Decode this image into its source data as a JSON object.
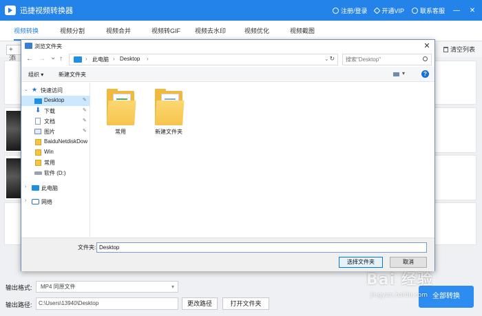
{
  "app": {
    "title": "迅捷视频转换器",
    "login": "注册/登录",
    "vip": "开通VIP",
    "support": "联系客服",
    "minimize": "—",
    "close": "✕"
  },
  "tabs": [
    {
      "label": "视频转换"
    },
    {
      "label": "视频分割"
    },
    {
      "label": "视频合并"
    },
    {
      "label": "视频转GIF"
    },
    {
      "label": "视频去水印"
    },
    {
      "label": "视频优化"
    },
    {
      "label": "视频截图"
    }
  ],
  "toolbar": {
    "add_label": "+ 添",
    "clear_label": "清空列表"
  },
  "bottom": {
    "format_label": "输出格式:",
    "format_value": "MP4  同原文件",
    "path_label": "输出路径:",
    "path_value": "C:\\Users\\13940\\Desktop",
    "change_path": "更改路径",
    "open_folder": "打开文件夹",
    "convert_all": "全部转换"
  },
  "dialog": {
    "title": "浏览文件夹",
    "close": "✕",
    "nav": {
      "back": "←",
      "forward": "→",
      "dropdown": "⌄",
      "up": "↑"
    },
    "address": {
      "segments": [
        "此电脑",
        "Desktop"
      ],
      "chevron": "›",
      "refresh": "↻"
    },
    "search_placeholder": "搜索\"Desktop\"",
    "commands": {
      "organize": "组织 ▾",
      "new_folder": "新建文件夹",
      "help": "?"
    },
    "tree": [
      {
        "label": "快速访问",
        "pinned": false
      },
      {
        "label": "Desktop",
        "pinned": true,
        "selected": true
      },
      {
        "label": "下载",
        "pinned": true
      },
      {
        "label": "文档",
        "pinned": true
      },
      {
        "label": "图片",
        "pinned": true
      },
      {
        "label": "BaiduNetdiskDow",
        "pinned": false
      },
      {
        "label": "Win",
        "pinned": false
      },
      {
        "label": "常用",
        "pinned": false
      },
      {
        "label": "软件 (D:)",
        "pinned": false
      },
      {
        "label": "此电脑",
        "pinned": false
      },
      {
        "label": "网络",
        "pinned": false
      }
    ],
    "pin_glyph": "✎",
    "expand_open": "⌄",
    "expand_closed": "›",
    "folders": [
      {
        "name": "常用"
      },
      {
        "name": "新建文件夹"
      }
    ],
    "footer": {
      "filename_label": "文件夹:",
      "filename_value": "Desktop",
      "select_button": "选择文件夹",
      "cancel_button": "取消"
    }
  },
  "watermark": {
    "main": "Bai 经验",
    "sub": "jingyan.baidu.com"
  },
  "colors": {
    "brand": "#2483e9",
    "primary_button": "#2d8cf0",
    "selection": "#cce8ff"
  }
}
